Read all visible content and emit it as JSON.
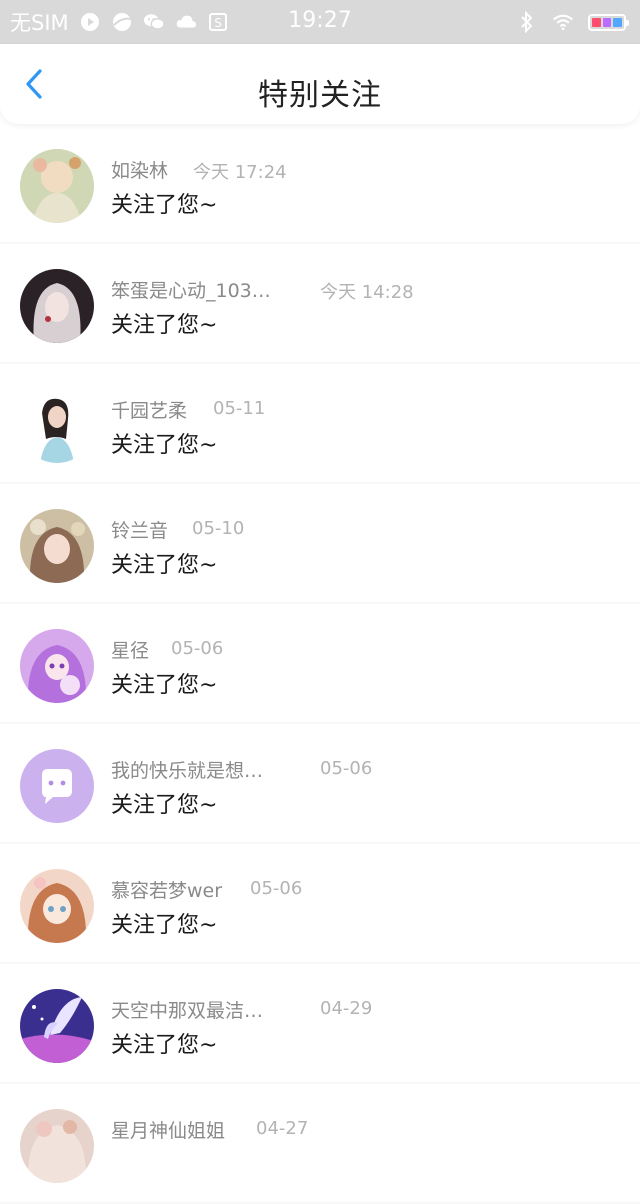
{
  "status_bar": {
    "carrier": "无SIM",
    "time": "19:27",
    "icons_left": [
      "play-icon",
      "browser-icon",
      "wechat-icon",
      "weather-icon",
      "s-app-icon"
    ],
    "icons_right": [
      "bluetooth-icon",
      "wifi-icon",
      "battery-icon"
    ],
    "battery_colors": [
      "#ff4d6d",
      "#b96cff",
      "#52a8ff"
    ]
  },
  "nav": {
    "back_icon": "chevron-left-icon",
    "title": "特别关注",
    "accent": "#2f97f5"
  },
  "items": [
    {
      "name": "如染林",
      "time": "今天 17:24",
      "message": "关注了您~"
    },
    {
      "name": "笨蛋是心动_103…",
      "time": "今天 14:28",
      "message": "关注了您~"
    },
    {
      "name": "千园艺柔",
      "time": "05-11",
      "message": "关注了您~"
    },
    {
      "name": "铃兰音",
      "time": "05-10",
      "message": "关注了您~"
    },
    {
      "name": "星径",
      "time": "05-06",
      "message": "关注了您~"
    },
    {
      "name": "我的快乐就是想…",
      "time": "05-06",
      "message": "关注了您~"
    },
    {
      "name": "慕容若梦wer",
      "time": "05-06",
      "message": "关注了您~"
    },
    {
      "name": "天空中那双最洁…",
      "time": "04-29",
      "message": "关注了您~"
    },
    {
      "name": "星月神仙姐姐",
      "time": "04-27",
      "message": ""
    }
  ]
}
